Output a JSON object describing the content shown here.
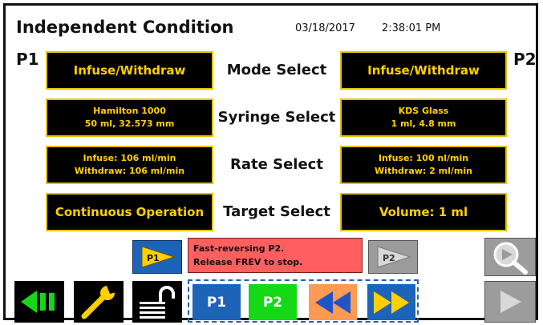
{
  "header": {
    "title": "Independent Condition",
    "date": "03/18/2017",
    "time": "2:38:01 PM"
  },
  "pumps": {
    "p1_label": "P1",
    "p2_label": "P2"
  },
  "rows": [
    {
      "label": "Mode Select",
      "p1": [
        "Infuse/Withdraw"
      ],
      "p2": [
        "Infuse/Withdraw"
      ]
    },
    {
      "label": "Syringe Select",
      "p1": [
        "Hamilton 1000",
        "50 ml, 32.573 mm"
      ],
      "p2": [
        "KDS Glass",
        "1 ml, 4.8 mm"
      ]
    },
    {
      "label": "Rate Select",
      "p1": [
        "Infuse: 106 ml/min",
        "Withdraw: 106 ml/min"
      ],
      "p2": [
        "Infuse: 100 nl/min",
        "Withdraw: 2 ml/min"
      ]
    },
    {
      "label": "Target Select",
      "p1": [
        "Continuous Operation"
      ],
      "p2": [
        "Volume: 1 ml"
      ]
    }
  ],
  "status": {
    "line1": "Fast-reversing P2.",
    "line2": "Release FREV to stop."
  },
  "controls": {
    "run_p1_label": "P1",
    "run_p2_label": "P2",
    "select_p1_label": "P1",
    "select_p2_label": "P2"
  },
  "colors": {
    "cell_bg": "#000000",
    "cell_text": "#ffd000",
    "status_bg": "#ff5f5f",
    "blue_button": "#1d63b8",
    "green_button": "#16d816",
    "orange_button": "#ff9a52"
  },
  "icons": [
    "back-icon",
    "wrench-icon",
    "unlock-icon",
    "play-p1-icon",
    "play-p2-icon",
    "rewind-icon",
    "fast-forward-icon",
    "search-icon",
    "run-icon"
  ]
}
